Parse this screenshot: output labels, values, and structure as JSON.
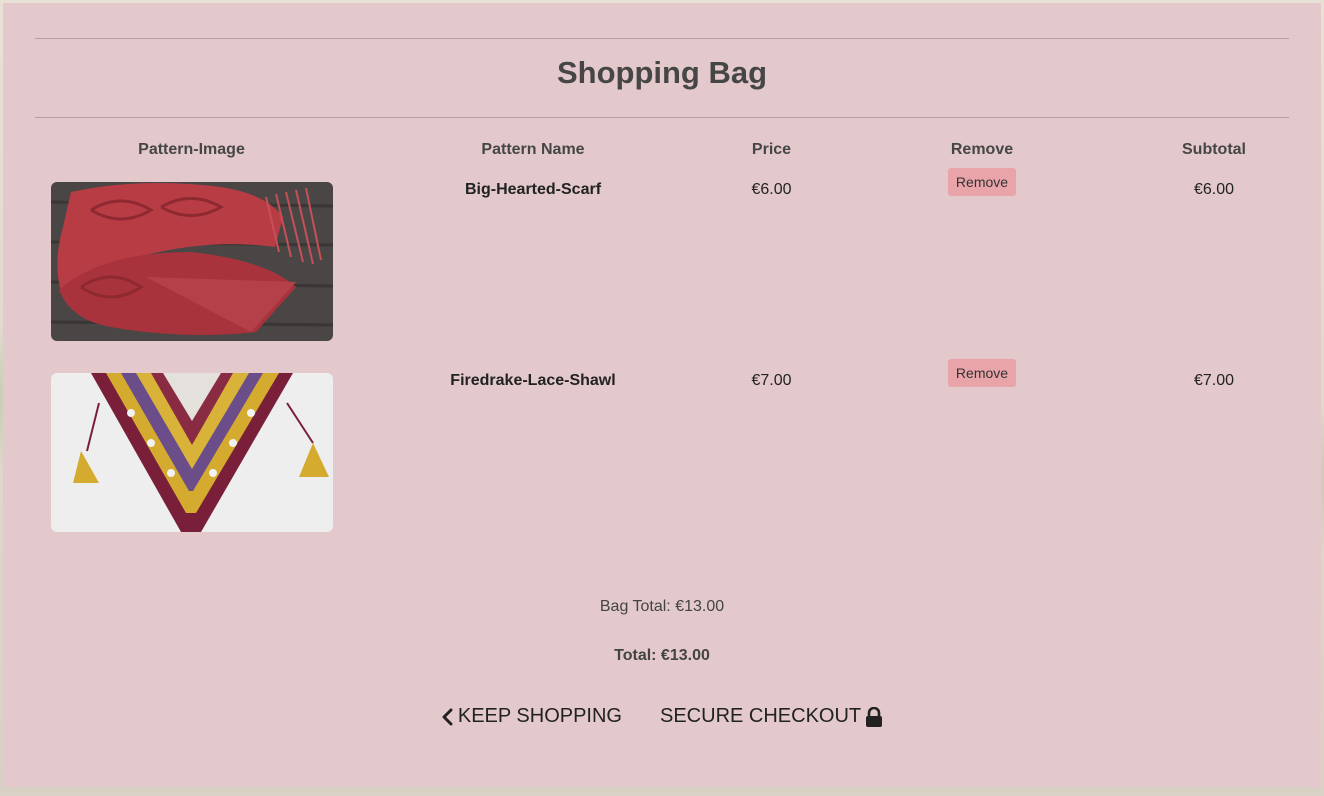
{
  "page": {
    "title": "Shopping Bag"
  },
  "table": {
    "headers": [
      "Pattern-Image",
      "Pattern Name",
      "Price",
      "Remove",
      "Subtotal"
    ],
    "rows": [
      {
        "name": "Big-Hearted-Scarf",
        "price": "€6.00",
        "remove_label": "Remove",
        "subtotal": "€6.00",
        "image": "red-cabled-scarf-photo"
      },
      {
        "name": "Firedrake-Lace-Shawl",
        "price": "€7.00",
        "remove_label": "Remove",
        "subtotal": "€7.00",
        "image": "purple-yellow-lace-shawl-photo"
      }
    ]
  },
  "totals": {
    "bag_total": "Bag Total: €13.00",
    "grand_total": "Total: €13.00"
  },
  "actions": {
    "keep_shopping": "KEEP SHOPPING",
    "secure_checkout": "SECURE CHECKOUT"
  },
  "icons": {
    "keep_shopping": "chevron-left-icon",
    "secure_checkout": "lock-icon"
  },
  "colors": {
    "panel": "#e3c9cb",
    "remove_button": "#e8a4a9",
    "text": "#3f3f3f"
  }
}
